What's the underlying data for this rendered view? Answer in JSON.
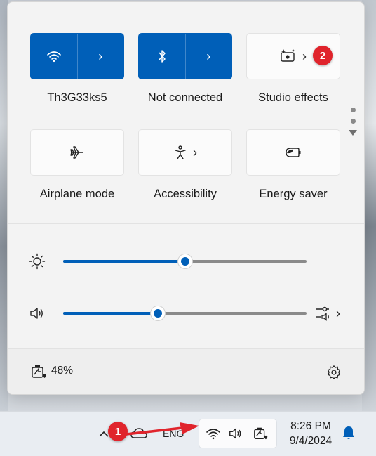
{
  "quick_settings": {
    "tiles": [
      {
        "id": "wifi",
        "label": "Th3G33ks5",
        "icon": "wifi-icon",
        "active": true,
        "has_chevron": true
      },
      {
        "id": "bluetooth",
        "label": "Not connected",
        "icon": "bluetooth-icon",
        "active": true,
        "has_chevron": true
      },
      {
        "id": "studio",
        "label": "Studio effects",
        "icon": "studio-effects-icon",
        "active": false,
        "has_chevron": true
      },
      {
        "id": "airplane",
        "label": "Airplane mode",
        "icon": "airplane-icon",
        "active": false,
        "has_chevron": false
      },
      {
        "id": "accessibility",
        "label": "Accessibility",
        "icon": "accessibility-icon",
        "active": false,
        "has_chevron": true
      },
      {
        "id": "energy",
        "label": "Energy saver",
        "icon": "energy-saver-icon",
        "active": false,
        "has_chevron": false
      }
    ],
    "pager": {
      "pages": 2,
      "current": 1
    }
  },
  "sliders": {
    "brightness": {
      "icon": "brightness-icon",
      "value": 0.5
    },
    "volume": {
      "icon": "speaker-icon",
      "value": 0.39
    }
  },
  "footer": {
    "battery_percent": "48%",
    "battery_icon": "battery-charging-icon",
    "settings_icon": "gear-icon"
  },
  "taskbar": {
    "language_partial": "ENG",
    "time": "8:26 PM",
    "date": "9/4/2024",
    "icons": [
      "chevron-up-icon",
      "cloud-icon",
      "wifi-icon",
      "speaker-icon",
      "battery-charging-icon",
      "bell-icon"
    ]
  },
  "annotations": {
    "badge_1": "1",
    "badge_2": "2"
  },
  "colors": {
    "accent": "#005fb8",
    "badge": "#e0242c"
  }
}
